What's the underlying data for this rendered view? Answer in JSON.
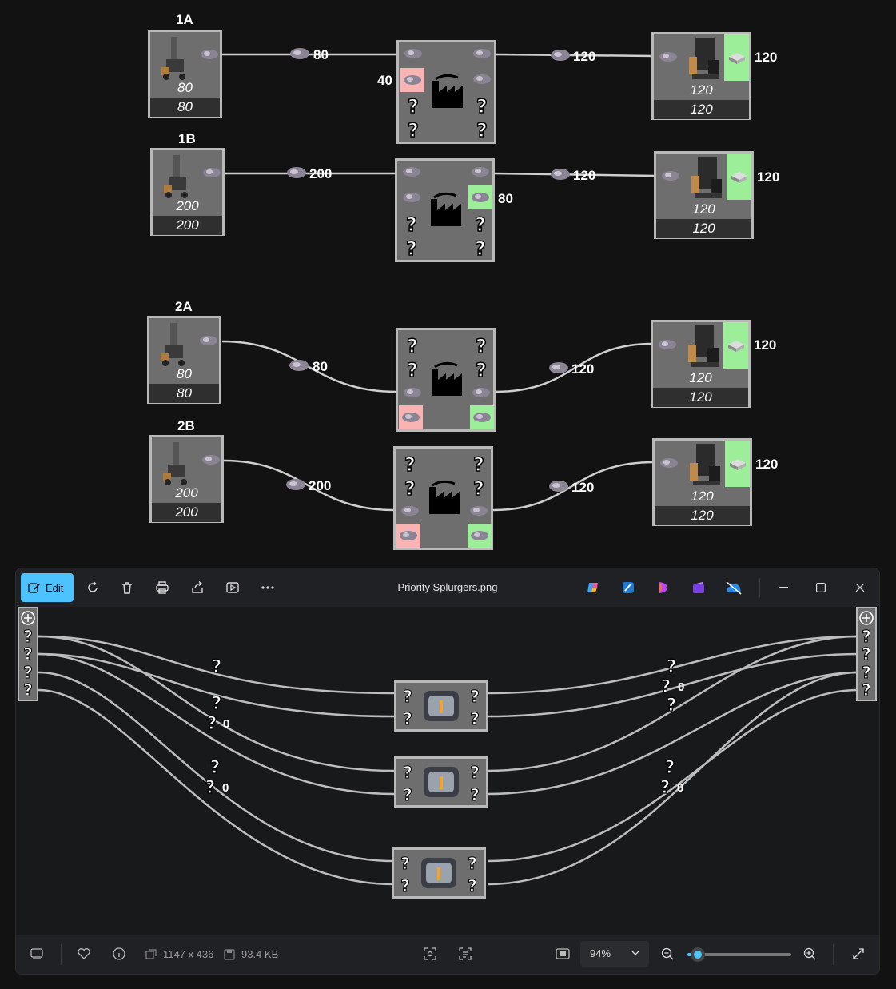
{
  "sections": {
    "s1a": {
      "label": "1A",
      "drill_rate": "80",
      "drill_out": "80",
      "drill_in": "80",
      "hub_side": "40",
      "out_rate": "120",
      "sm_out": "120",
      "sm_in": "120",
      "sm_rate": "120"
    },
    "s1b": {
      "label": "1B",
      "drill_rate": "200",
      "drill_out": "200",
      "drill_in": "200",
      "hub_side": "80",
      "out_rate": "120",
      "sm_out": "120",
      "sm_in": "120",
      "sm_rate": "120"
    },
    "s2a": {
      "label": "2A",
      "drill_rate": "80",
      "drill_out": "80",
      "drill_in": "80",
      "out_rate": "120",
      "sm_out": "120",
      "sm_in": "120",
      "sm_rate": "120"
    },
    "s2b": {
      "label": "2B",
      "drill_rate": "200",
      "drill_out": "200",
      "drill_in": "200",
      "out_rate": "120",
      "sm_out": "120",
      "sm_in": "120",
      "sm_rate": "120"
    }
  },
  "viewer": {
    "edit_label": "Edit",
    "file_title": "Priority Splurgers.png",
    "dimensions": "1147 x 436",
    "file_size": "93.4 KB",
    "zoom": "94%",
    "zoom_level": 0.1,
    "canvas": {
      "zero_labels": [
        "0",
        "0",
        "0",
        "0"
      ]
    }
  },
  "colors": {
    "output_tile": "#9dee98",
    "input_tile": "#f9b3b3",
    "accent": "#4cc2ff"
  }
}
